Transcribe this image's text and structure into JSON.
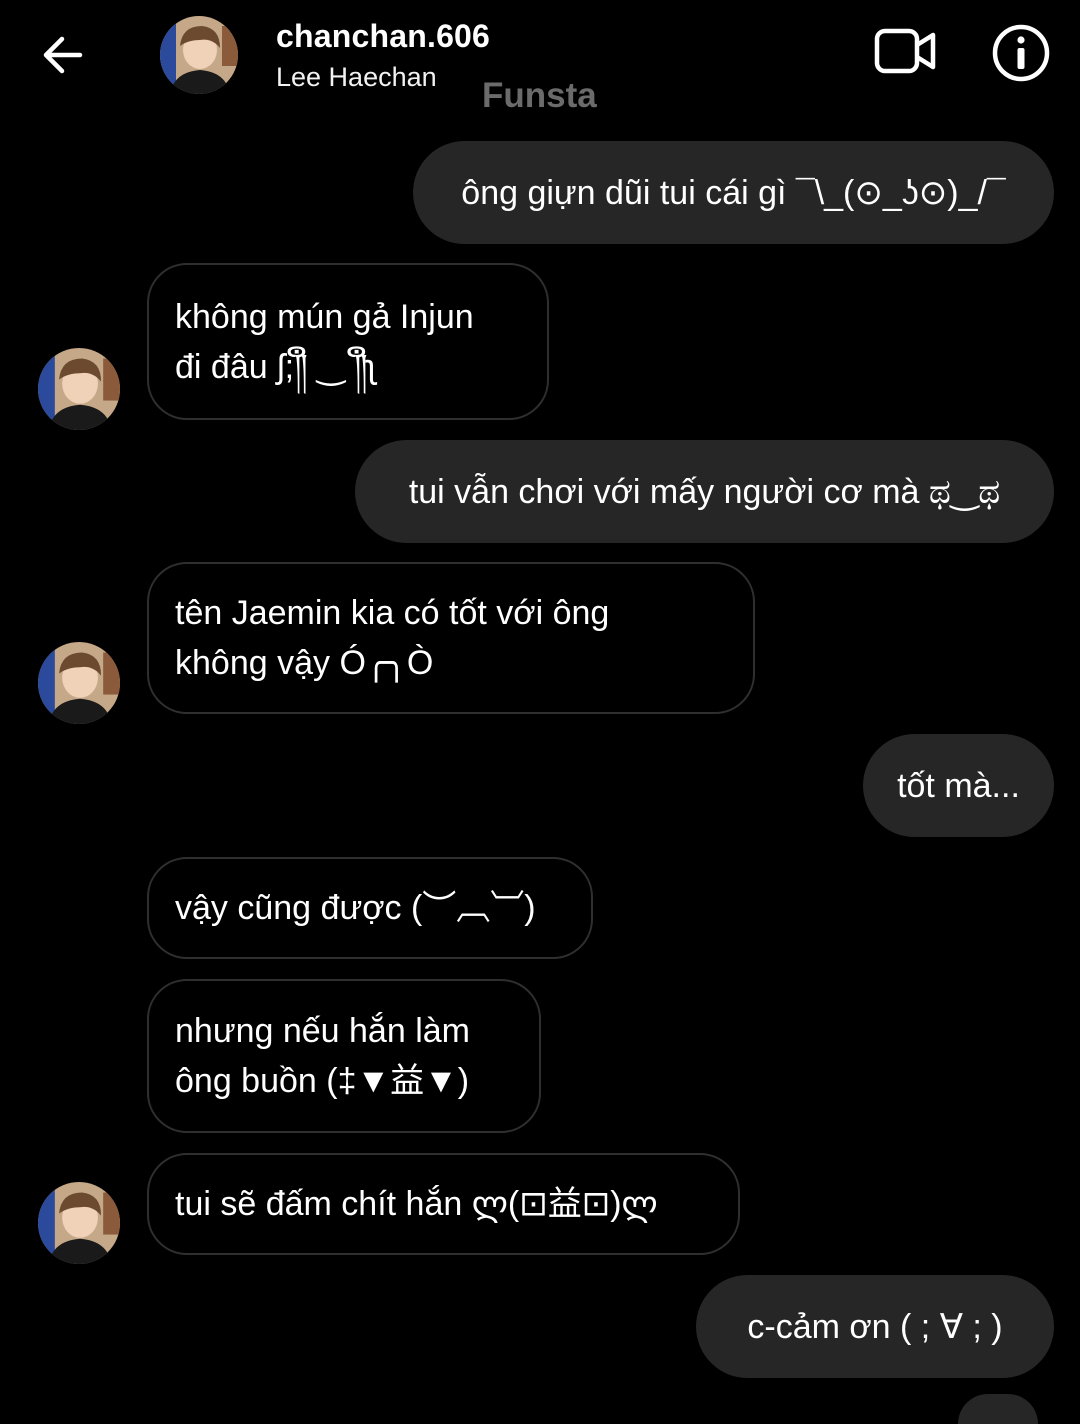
{
  "header": {
    "back_icon": "arrow-left-icon",
    "username": "chanchan.606",
    "real_name": "Lee Haechan",
    "video_icon": "video-call-icon",
    "info_icon": "info-icon"
  },
  "watermark": "Funsta",
  "messages": [
    {
      "direction": "sent",
      "text": "ông giựn dũi tui cái gì ¯\\_(⊙_ʖ⊙)_/¯"
    },
    {
      "direction": "received",
      "text": "không mún gả Injun\nđi đâu ʃ;༎ຶ ‿ ༎ຶʅ"
    },
    {
      "direction": "sent",
      "text": "tui vẫn chơi với mấy người cơ mà ಥ‿ಥ"
    },
    {
      "direction": "received",
      "text": "tên Jaemin kia có tốt với ông\nkhông vậy Ó╭╮Ò"
    },
    {
      "direction": "sent",
      "text": "tốt mà..."
    },
    {
      "direction": "received",
      "text": "vậy cũng được (︶︹︺)"
    },
    {
      "direction": "received",
      "text": "nhưng nếu hắn làm\nông buồn (‡▼益▼)"
    },
    {
      "direction": "received",
      "text": "tui sẽ đấm chít hắn ლ(⊡益⊡)ლ"
    },
    {
      "direction": "sent",
      "text": "c-cảm ơn ( ; ∀ ; )"
    }
  ]
}
